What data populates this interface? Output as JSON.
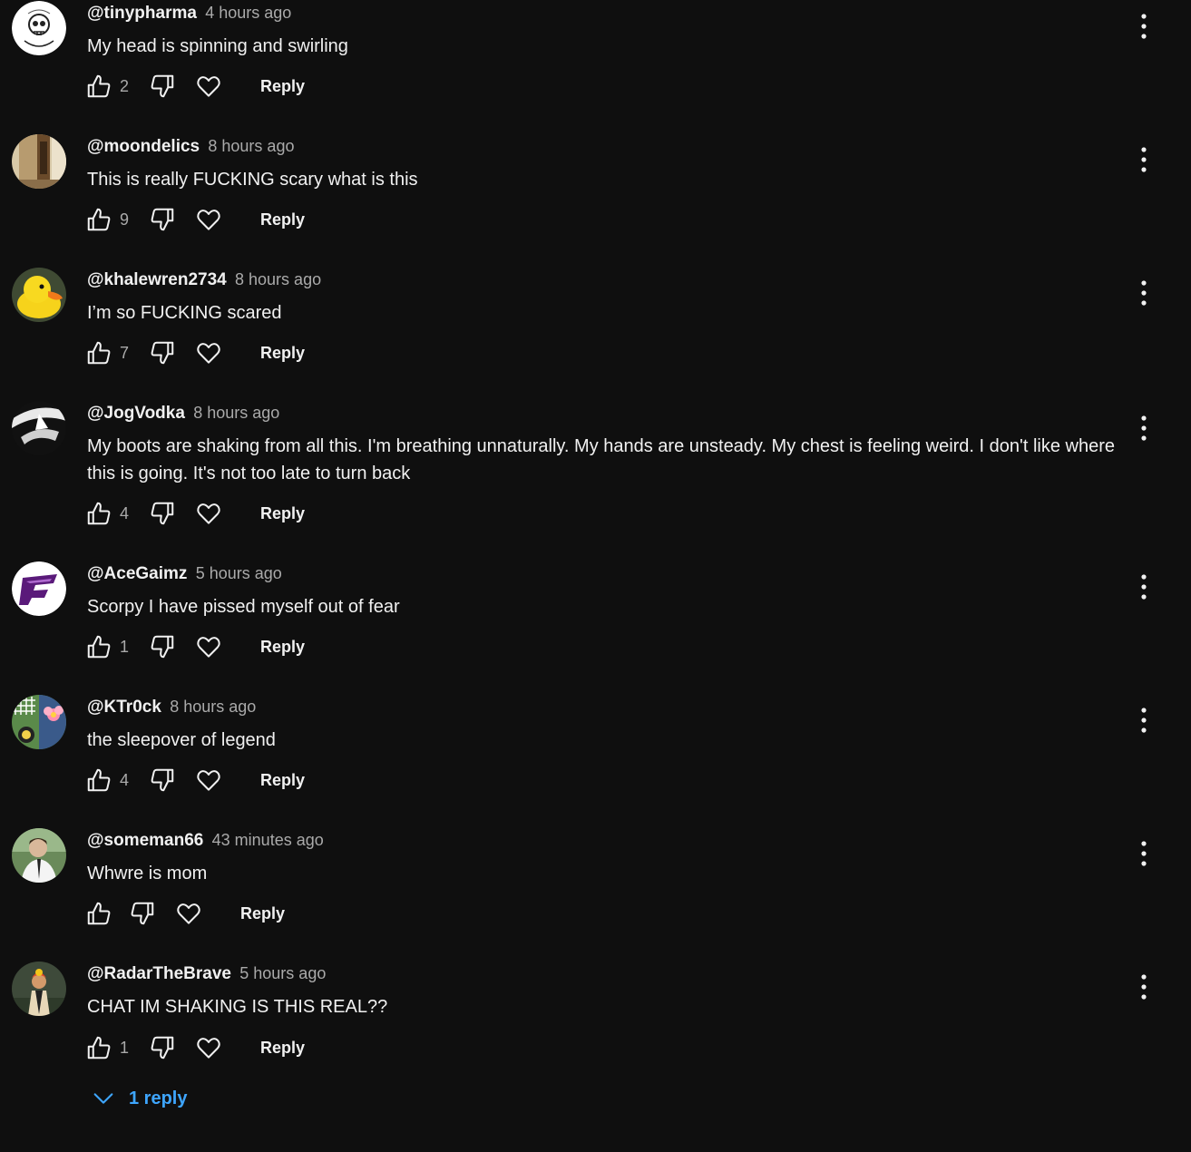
{
  "comments": [
    {
      "author": "@tinypharma",
      "time": "4 hours ago",
      "text": "My head is spinning and swirling",
      "likes": "2",
      "reply": "Reply",
      "avatar": "sketch-skull-avatar"
    },
    {
      "author": "@moondelics",
      "time": "8 hours ago",
      "text": "This is really FUCKING scary what is this",
      "likes": "9",
      "reply": "Reply",
      "avatar": "room-photo-avatar"
    },
    {
      "author": "@khalewren2734",
      "time": "8 hours ago",
      "text": "I’m so FUCKING scared",
      "likes": "7",
      "reply": "Reply",
      "avatar": "rubber-duck-avatar"
    },
    {
      "author": "@JogVodka",
      "time": "8 hours ago",
      "text": "My boots are shaking from all this. I'm breathing unnaturally. My hands are unsteady. My chest is feeling weird. I don't like where this is going. It's not too late to turn back",
      "likes": "4",
      "reply": "Reply",
      "avatar": "black-white-art-avatar"
    },
    {
      "author": "@AceGaimz",
      "time": "5 hours ago",
      "text": "Scorpy I have pissed myself out of fear",
      "likes": "1",
      "reply": "Reply",
      "avatar": "purple-logo-avatar"
    },
    {
      "author": "@KTr0ck",
      "time": "8 hours ago",
      "text": "the sleepover of legend",
      "likes": "4",
      "reply": "Reply",
      "avatar": "flower-art-avatar"
    },
    {
      "author": "@someman66",
      "time": "43 minutes ago",
      "text": "Whwre is mom",
      "likes": "",
      "reply": "Reply",
      "avatar": "man-photo-avatar"
    },
    {
      "author": "@RadarTheBrave",
      "time": "5 hours ago",
      "text": "CHAT IM SHAKING IS THIS REAL??",
      "likes": "1",
      "reply": "Reply",
      "avatar": "person-photo-avatar"
    }
  ],
  "replies_toggle": {
    "label": "1 reply",
    "icon": "chevron-down-icon"
  },
  "colors": {
    "background": "#0f0f0f",
    "text": "#f1f1f1",
    "secondary": "#aaaaaa",
    "link": "#3ea6ff"
  }
}
